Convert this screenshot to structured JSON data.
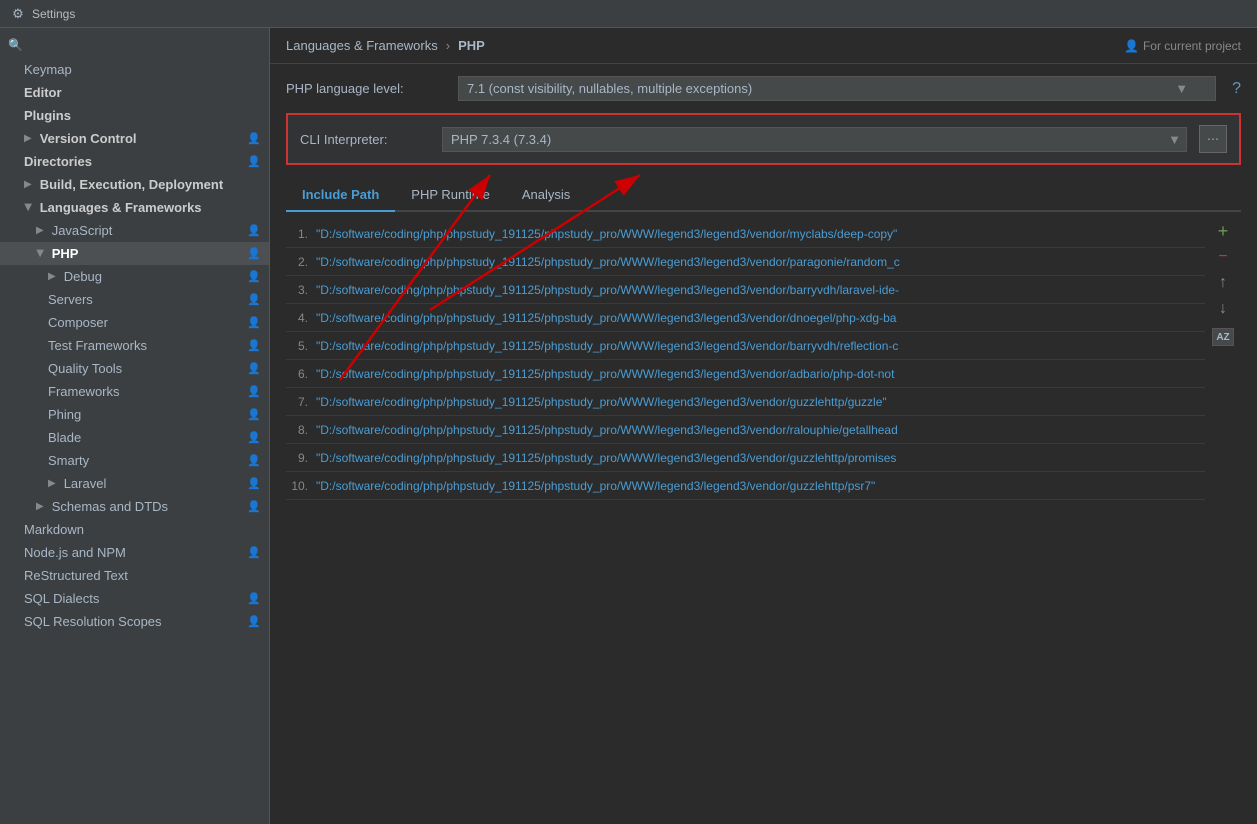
{
  "titleBar": {
    "title": "Settings",
    "icon": "⚙"
  },
  "sidebar": {
    "searchPlaceholder": "Search settings",
    "items": [
      {
        "id": "keymap",
        "label": "Keymap",
        "indent": 0,
        "hasArrow": false,
        "hasUser": false,
        "expanded": false
      },
      {
        "id": "editor",
        "label": "Editor",
        "indent": 0,
        "hasArrow": false,
        "hasUser": false,
        "bold": true
      },
      {
        "id": "plugins",
        "label": "Plugins",
        "indent": 0,
        "hasArrow": false,
        "hasUser": false,
        "bold": true
      },
      {
        "id": "version-control",
        "label": "Version Control",
        "indent": 0,
        "hasArrow": true,
        "hasUser": true,
        "bold": true
      },
      {
        "id": "directories",
        "label": "Directories",
        "indent": 0,
        "hasArrow": false,
        "hasUser": true,
        "bold": true
      },
      {
        "id": "build-exec-deploy",
        "label": "Build, Execution, Deployment",
        "indent": 0,
        "hasArrow": true,
        "hasUser": false,
        "bold": true
      },
      {
        "id": "languages-frameworks",
        "label": "Languages & Frameworks",
        "indent": 0,
        "hasArrow": true,
        "hasUser": false,
        "bold": true,
        "expanded": true
      },
      {
        "id": "javascript",
        "label": "JavaScript",
        "indent": 1,
        "hasArrow": true,
        "hasUser": true
      },
      {
        "id": "php",
        "label": "PHP",
        "indent": 1,
        "hasArrow": true,
        "hasUser": true,
        "selected": true
      },
      {
        "id": "debug",
        "label": "Debug",
        "indent": 2,
        "hasArrow": true,
        "hasUser": true
      },
      {
        "id": "servers",
        "label": "Servers",
        "indent": 2,
        "hasArrow": false,
        "hasUser": true,
        "alert": true
      },
      {
        "id": "composer",
        "label": "Composer",
        "indent": 2,
        "hasArrow": false,
        "hasUser": true
      },
      {
        "id": "test-frameworks",
        "label": "Test Frameworks",
        "indent": 2,
        "hasArrow": false,
        "hasUser": true
      },
      {
        "id": "quality-tools",
        "label": "Quality Tools",
        "indent": 2,
        "hasArrow": false,
        "hasUser": true
      },
      {
        "id": "frameworks",
        "label": "Frameworks",
        "indent": 2,
        "hasArrow": false,
        "hasUser": true
      },
      {
        "id": "phing",
        "label": "Phing",
        "indent": 2,
        "hasArrow": false,
        "hasUser": true
      },
      {
        "id": "blade",
        "label": "Blade",
        "indent": 2,
        "hasArrow": false,
        "hasUser": true
      },
      {
        "id": "smarty",
        "label": "Smarty",
        "indent": 2,
        "hasArrow": false,
        "hasUser": true
      },
      {
        "id": "laravel",
        "label": "Laravel",
        "indent": 2,
        "hasArrow": true,
        "hasUser": true
      },
      {
        "id": "schemas-dtds",
        "label": "Schemas and DTDs",
        "indent": 1,
        "hasArrow": true,
        "hasUser": true
      },
      {
        "id": "markdown",
        "label": "Markdown",
        "indent": 0,
        "hasArrow": false,
        "hasUser": false
      },
      {
        "id": "nodejs-npm",
        "label": "Node.js and NPM",
        "indent": 0,
        "hasArrow": false,
        "hasUser": true
      },
      {
        "id": "restructured-text",
        "label": "ReStructured Text",
        "indent": 0,
        "hasArrow": false,
        "hasUser": false
      },
      {
        "id": "sql-dialects",
        "label": "SQL Dialects",
        "indent": 0,
        "hasArrow": false,
        "hasUser": true
      },
      {
        "id": "sql-resolution-scopes",
        "label": "SQL Resolution Scopes",
        "indent": 0,
        "hasArrow": false,
        "hasUser": true
      }
    ]
  },
  "breadcrumb": {
    "parent": "Languages & Frameworks",
    "separator": "›",
    "current": "PHP",
    "projectLabel": "For current project",
    "projectIcon": "👤"
  },
  "phpSettings": {
    "levelLabel": "PHP language level:",
    "levelValue": "7.1 (const visibility, nullables, multiple exceptions)",
    "helpIcon": "?",
    "cliLabel": "CLI Interpreter:",
    "cliValue": "PHP 7.3.4 (7.3.4)"
  },
  "tabs": [
    {
      "id": "include-path",
      "label": "Include Path",
      "active": true
    },
    {
      "id": "php-runtime",
      "label": "PHP Runtime",
      "active": false
    },
    {
      "id": "analysis",
      "label": "Analysis",
      "active": false
    }
  ],
  "paths": [
    {
      "num": "1.",
      "path": "\"D:/software/coding/php/phpstudy_191125/phpstudy_pro/WWW/legend3/legend3/vendor/myclabs/deep-copy\""
    },
    {
      "num": "2.",
      "path": "\"D:/software/coding/php/phpstudy_191125/phpstudy_pro/WWW/legend3/legend3/vendor/paragonie/random_c"
    },
    {
      "num": "3.",
      "path": "\"D:/software/coding/php/phpstudy_191125/phpstudy_pro/WWW/legend3/legend3/vendor/barryvdh/laravel-ide-"
    },
    {
      "num": "4.",
      "path": "\"D:/software/coding/php/phpstudy_191125/phpstudy_pro/WWW/legend3/legend3/vendor/dnoegel/php-xdg-ba"
    },
    {
      "num": "5.",
      "path": "\"D:/software/coding/php/phpstudy_191125/phpstudy_pro/WWW/legend3/legend3/vendor/barryvdh/reflection-c"
    },
    {
      "num": "6.",
      "path": "\"D:/software/coding/php/phpstudy_191125/phpstudy_pro/WWW/legend3/legend3/vendor/adbario/php-dot-not"
    },
    {
      "num": "7.",
      "path": "\"D:/software/coding/php/phpstudy_191125/phpstudy_pro/WWW/legend3/legend3/vendor/guzzlehttp/guzzle\""
    },
    {
      "num": "8.",
      "path": "\"D:/software/coding/php/phpstudy_191125/phpstudy_pro/WWW/legend3/legend3/vendor/ralouphie/getallhead"
    },
    {
      "num": "9.",
      "path": "\"D:/software/coding/php/phpstudy_191125/phpstudy_pro/WWW/legend3/legend3/vendor/guzzlehttp/promises"
    },
    {
      "num": "10.",
      "path": "\"D:/software/coding/php/phpstudy_191125/phpstudy_pro/WWW/legend3/legend3/vendor/guzzlehttp/psr7\""
    }
  ],
  "sideActions": {
    "add": "+",
    "remove": "−",
    "moveUp": "↑",
    "moveDown": "↓",
    "sort": "AZ"
  }
}
